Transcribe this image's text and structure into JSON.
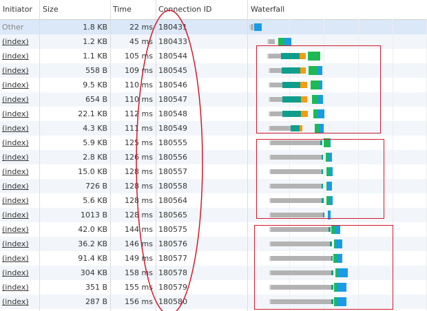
{
  "columns": {
    "initiator": "Initiator",
    "size": "Size",
    "time": "Time",
    "connection_id": "Connection ID",
    "waterfall": "Waterfall"
  },
  "colors": {
    "row_alt": "#f2f6fb",
    "row_selected": "#dbe8f7",
    "stalled": "#b3b3b3",
    "waiting": "#a4a4a4",
    "initial_connection": "#f39c12",
    "ssl": "#0f9d8c",
    "ttfb": "#1db954",
    "download": "#1a9be6",
    "annotation": "#d0182a"
  },
  "rows": [
    {
      "initiator": "Other",
      "size": "1.8 KB",
      "time": "22 ms",
      "connection_id": "180431"
    },
    {
      "initiator": "(index)",
      "size": "1.2 KB",
      "time": "45 ms",
      "connection_id": "180433"
    },
    {
      "initiator": "(index)",
      "size": "1.1 KB",
      "time": "105 ms",
      "connection_id": "180544"
    },
    {
      "initiator": "(index)",
      "size": "558 B",
      "time": "109 ms",
      "connection_id": "180545"
    },
    {
      "initiator": "(index)",
      "size": "9.5 KB",
      "time": "110 ms",
      "connection_id": "180546"
    },
    {
      "initiator": "(index)",
      "size": "654 B",
      "time": "110 ms",
      "connection_id": "180547"
    },
    {
      "initiator": "(index)",
      "size": "22.1 KB",
      "time": "112 ms",
      "connection_id": "180548"
    },
    {
      "initiator": "(index)",
      "size": "4.3 KB",
      "time": "111 ms",
      "connection_id": "180549"
    },
    {
      "initiator": "(index)",
      "size": "5.9 KB",
      "time": "125 ms",
      "connection_id": "180555"
    },
    {
      "initiator": "(index)",
      "size": "2.8 KB",
      "time": "126 ms",
      "connection_id": "180556"
    },
    {
      "initiator": "(index)",
      "size": "15.0 KB",
      "time": "128 ms",
      "connection_id": "180557"
    },
    {
      "initiator": "(index)",
      "size": "726 B",
      "time": "128 ms",
      "connection_id": "180558"
    },
    {
      "initiator": "(index)",
      "size": "5.6 KB",
      "time": "128 ms",
      "connection_id": "180564"
    },
    {
      "initiator": "(index)",
      "size": "1013 B",
      "time": "128 ms",
      "connection_id": "180565"
    },
    {
      "initiator": "(index)",
      "size": "42.0 KB",
      "time": "144 ms",
      "connection_id": "180575"
    },
    {
      "initiator": "(index)",
      "size": "36.2 KB",
      "time": "146 ms",
      "connection_id": "180576"
    },
    {
      "initiator": "(index)",
      "size": "91.4 KB",
      "time": "149 ms",
      "connection_id": "180577"
    },
    {
      "initiator": "(index)",
      "size": "304 KB",
      "time": "158 ms",
      "connection_id": "180578"
    },
    {
      "initiator": "(index)",
      "size": "351 B",
      "time": "155 ms",
      "connection_id": "180579"
    },
    {
      "initiator": "(index)",
      "size": "287 B",
      "time": "156 ms",
      "connection_id": "180580"
    }
  ]
}
